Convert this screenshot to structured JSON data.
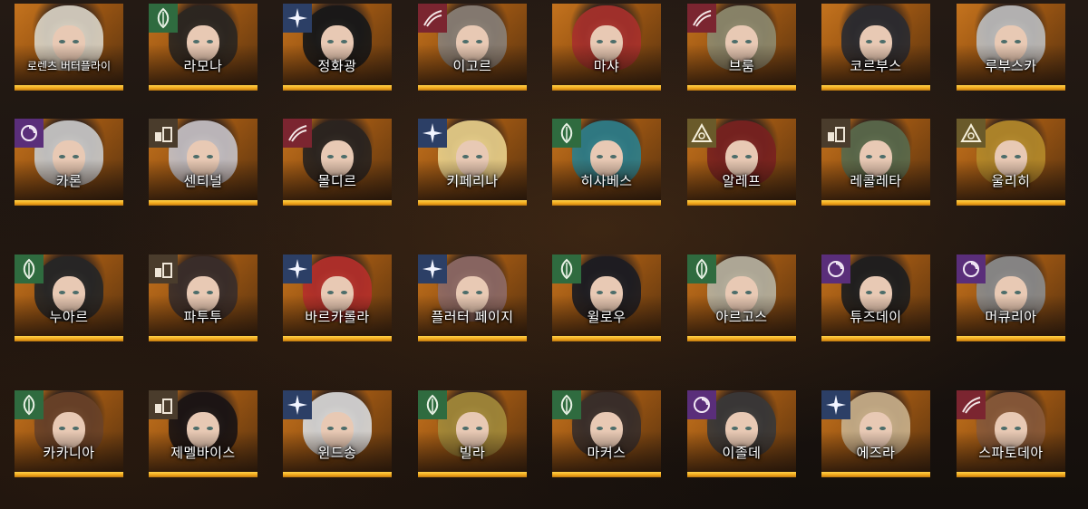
{
  "cards": [
    {
      "name": "로렌츠 버터플라이",
      "badge": "none",
      "hair": "#d9d2c4"
    },
    {
      "name": "라모나",
      "badge": "leaf",
      "hair": "#2b2621"
    },
    {
      "name": "정화광",
      "badge": "star",
      "hair": "#181818"
    },
    {
      "name": "이고르",
      "badge": "beast",
      "hair": "#8a8076"
    },
    {
      "name": "마샤",
      "badge": "none",
      "hair": "#a8312b"
    },
    {
      "name": "브룸",
      "badge": "beast",
      "hair": "#8e8a6e"
    },
    {
      "name": "코르부스",
      "badge": "none",
      "hair": "#2b2b30"
    },
    {
      "name": "루부스카",
      "badge": "none",
      "hair": "#bdbdbd"
    },
    {
      "name": "카론",
      "badge": "mind",
      "hair": "#c9c9c9"
    },
    {
      "name": "센티널",
      "badge": "spirit",
      "hair": "#c6c1c6"
    },
    {
      "name": "몰디르",
      "badge": "beast",
      "hair": "#2a2420"
    },
    {
      "name": "키페리나",
      "badge": "star",
      "hair": "#e8cf8a"
    },
    {
      "name": "히사베스",
      "badge": "leaf",
      "hair": "#2f7f8a"
    },
    {
      "name": "알레프",
      "badge": "sky",
      "hair": "#7a2220"
    },
    {
      "name": "레콜레타",
      "badge": "spirit",
      "hair": "#5a6a4c"
    },
    {
      "name": "울리히",
      "badge": "sky",
      "hair": "#b58a2a"
    },
    {
      "name": "누아르",
      "badge": "leaf",
      "hair": "#262626"
    },
    {
      "name": "파투투",
      "badge": "spirit",
      "hair": "#3a2e2a"
    },
    {
      "name": "바르카롤라",
      "badge": "star",
      "hair": "#b5302a"
    },
    {
      "name": "플러터 페이지",
      "badge": "star",
      "hair": "#8e6a66"
    },
    {
      "name": "윌로우",
      "badge": "leaf",
      "hair": "#1c1c22"
    },
    {
      "name": "아르고스",
      "badge": "leaf",
      "hair": "#b7b2a0"
    },
    {
      "name": "튜즈데이",
      "badge": "mind",
      "hair": "#1e1e1e"
    },
    {
      "name": "머큐리아",
      "badge": "mind",
      "hair": "#8c8c8c"
    },
    {
      "name": "카카니아",
      "badge": "leaf",
      "hair": "#6a4228"
    },
    {
      "name": "제멜바이스",
      "badge": "spirit",
      "hair": "#1a1414"
    },
    {
      "name": "윈드송",
      "badge": "star",
      "hair": "#d8d8d8"
    },
    {
      "name": "빌라",
      "badge": "leaf",
      "hair": "#a48a3a"
    },
    {
      "name": "마커스",
      "badge": "leaf",
      "hair": "#3a2f2a"
    },
    {
      "name": "이졸데",
      "badge": "mind",
      "hair": "#3a3838"
    },
    {
      "name": "에즈라",
      "badge": "star",
      "hair": "#c9b08a"
    },
    {
      "name": "스파토데아",
      "badge": "beast",
      "hair": "#8a5a3a"
    }
  ]
}
